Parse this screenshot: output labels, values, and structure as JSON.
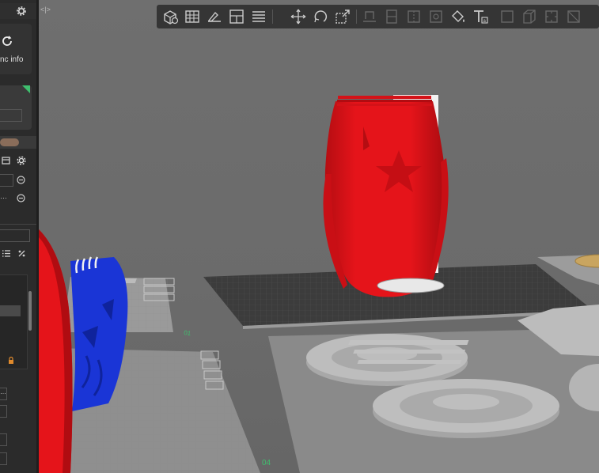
{
  "sidebar": {
    "sync_info_label": "nc info",
    "plate_labels": [
      "01",
      "04"
    ]
  },
  "colors": {
    "vase": "#e5141a",
    "helmet": "#1a35d6",
    "bed": "#3c3c3c",
    "parts": "#b8b8b8",
    "toolbar": "#353535"
  },
  "toolbar": {
    "icons": [
      "add-cube-icon",
      "grid-icon",
      "edit-image-icon",
      "layout-icon",
      "list-icon",
      "move-icon",
      "rotate-icon",
      "scale-icon",
      "cut-icon",
      "support-icon",
      "seam-icon",
      "fuzzy-icon",
      "paint-icon",
      "text-icon",
      "box-icon",
      "box-3d-icon",
      "measure-icon",
      "assemble-icon"
    ]
  }
}
